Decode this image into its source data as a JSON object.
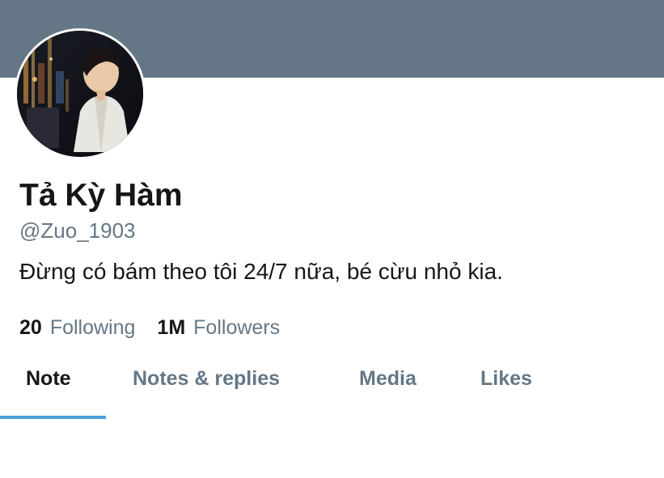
{
  "profile": {
    "display_name": "Tả Kỳ Hàm",
    "handle": "@Zuo_1903",
    "bio": "Đừng có bám theo tôi 24/7 nữa, bé cừu nhỏ kia.",
    "avatar_icon": "profile-photo"
  },
  "stats": {
    "following_count": "20",
    "following_label": "Following",
    "followers_count": "1M",
    "followers_label": "Followers"
  },
  "tabs": [
    {
      "label": "Note",
      "active": true
    },
    {
      "label": "Notes & replies",
      "active": false
    },
    {
      "label": "Media",
      "active": false
    },
    {
      "label": "Likes",
      "active": false
    }
  ],
  "colors": {
    "banner": "#657786",
    "accent": "#4a9fd6",
    "text_primary": "#14171a",
    "text_secondary": "#657786"
  }
}
